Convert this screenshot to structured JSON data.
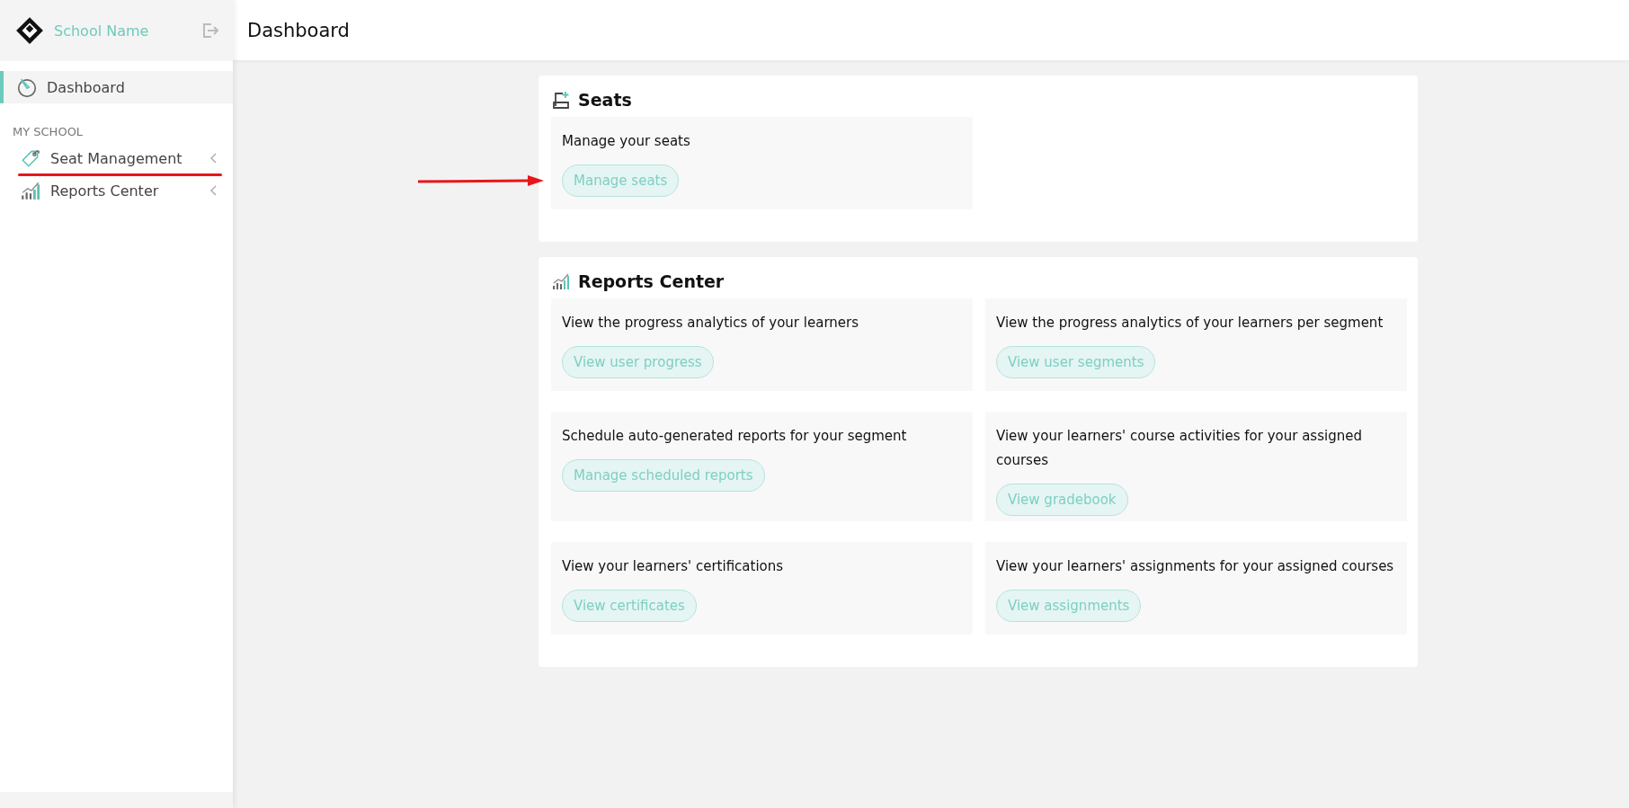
{
  "sidebar": {
    "school_name": "School Name",
    "items": [
      {
        "label": "Dashboard",
        "kind": "dashboard",
        "selected": true
      }
    ],
    "section": {
      "title": "MY SCHOOL",
      "items": [
        {
          "label": "Seat Management",
          "kind": "tag",
          "expanded": false,
          "selected": false,
          "underlined": true
        },
        {
          "label": "Reports Center",
          "kind": "chart",
          "expanded": false,
          "selected": false,
          "underlined": false
        }
      ]
    }
  },
  "header": {
    "title": "Dashboard"
  },
  "cards": [
    {
      "title": "Seats",
      "kind": "seat",
      "arrow_pointer": true,
      "tiles": [
        {
          "text": "Manage your seats",
          "button": "Manage seats"
        }
      ]
    },
    {
      "title": "Reports Center",
      "kind": "chart",
      "arrow_pointer": false,
      "tiles": [
        {
          "text": "View the progress analytics of your learners",
          "button": "View user progress"
        },
        {
          "text": "View the progress analytics of your learners per segment",
          "button": "View user segments"
        },
        {
          "text": "Schedule auto-generated reports for your segment",
          "button": "Manage scheduled reports"
        },
        {
          "text": "View your learners' course activities for your assigned courses",
          "button": "View gradebook"
        },
        {
          "text": "View your learners' certifications",
          "button": "View certificates"
        },
        {
          "text": "View your learners' assignments for your assigned courses",
          "button": "View assignments"
        }
      ]
    }
  ]
}
